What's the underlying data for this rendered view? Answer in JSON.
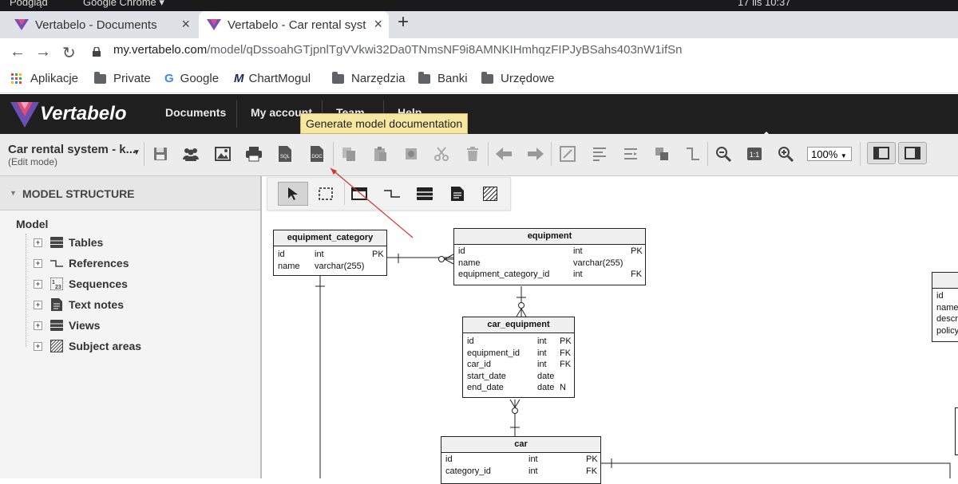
{
  "os_bar": {
    "left": "Podgląd",
    "app": "Google Chrome ▾",
    "time": "17 lis  10:37"
  },
  "browser": {
    "tabs": [
      {
        "title": "Vertabelo - Documents",
        "active": false
      },
      {
        "title": "Vertabelo - Car rental syst",
        "active": true
      }
    ],
    "new_tab": "+",
    "url_domain": "my.vertabelo.com",
    "url_path": "/model/qDssoahGTjpnlTgVVkwi32Da0TNmsNF9i8AMNKIHmhqzFIPJyBSahs403nW1ifSn",
    "bookmarks": [
      "Aplikacje",
      "Private",
      "Google",
      "ChartMogul",
      "Narzędzia",
      "Banki",
      "Urzędowe"
    ]
  },
  "app": {
    "brand": "Vertabelo",
    "menu": [
      "Documents",
      "My account",
      "Team",
      "Help"
    ],
    "tooltip": "Generate model documentation",
    "model_name": "Car rental system - k...",
    "model_mode": "(Edit mode)",
    "zoom": "100%",
    "accent_color": "#d84a7a"
  },
  "sidebar": {
    "title": "MODEL STRUCTURE",
    "root": "Model",
    "items": [
      {
        "label": "Tables",
        "icon": "table-icon"
      },
      {
        "label": "References",
        "icon": "reference-icon"
      },
      {
        "label": "Sequences",
        "icon": "sequence-icon"
      },
      {
        "label": "Text notes",
        "icon": "note-icon"
      },
      {
        "label": "Views",
        "icon": "view-icon"
      },
      {
        "label": "Subject areas",
        "icon": "subject-area-icon"
      }
    ]
  },
  "tables": {
    "equipment_category": {
      "name": "equipment_category",
      "rows": [
        {
          "col": "id",
          "type": "int",
          "key": "PK"
        },
        {
          "col": "name",
          "type": "varchar(255)",
          "key": ""
        }
      ]
    },
    "equipment": {
      "name": "equipment",
      "rows": [
        {
          "col": "id",
          "type": "int",
          "key": "PK"
        },
        {
          "col": "name",
          "type": "varchar(255)",
          "key": ""
        },
        {
          "col": "equipment_category_id",
          "type": "int",
          "key": "FK"
        }
      ]
    },
    "car_equipment": {
      "name": "car_equipment",
      "rows": [
        {
          "col": "id",
          "type": "int",
          "key": "PK"
        },
        {
          "col": "equipment_id",
          "type": "int",
          "key": "FK"
        },
        {
          "col": "car_id",
          "type": "int",
          "key": "FK"
        },
        {
          "col": "start_date",
          "type": "date",
          "key": ""
        },
        {
          "col": "end_date",
          "type": "date",
          "key": "N"
        }
      ]
    },
    "car": {
      "name": "car",
      "rows": [
        {
          "col": "id",
          "type": "int",
          "key": "PK"
        },
        {
          "col": "category_id",
          "type": "int",
          "key": "FK"
        }
      ]
    },
    "partial": {
      "rows": [
        "id",
        "name",
        "descr",
        "policy"
      ]
    }
  }
}
